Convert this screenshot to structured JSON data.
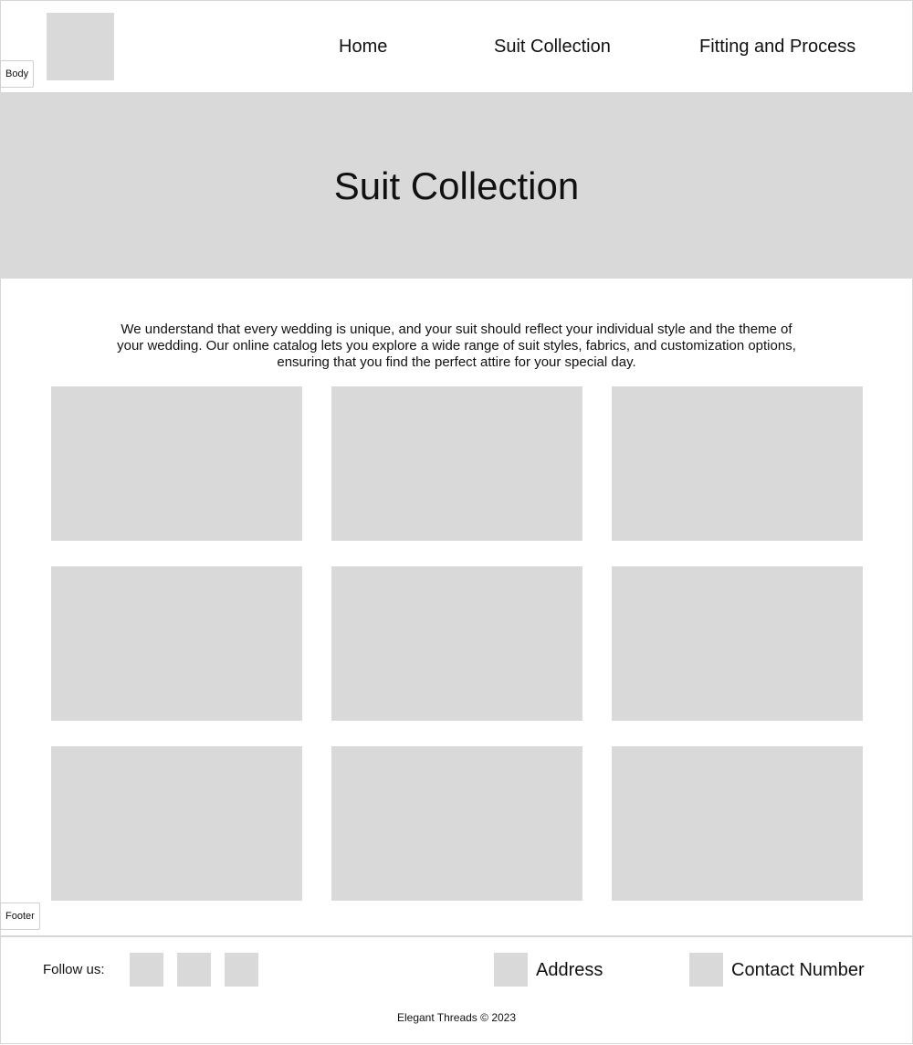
{
  "labels": {
    "body": "Body",
    "footer": "Footer"
  },
  "header": {
    "logo": "logo-placeholder",
    "nav": {
      "home": "Home",
      "suits": "Suit Collection",
      "fitting": "Fitting and Process"
    }
  },
  "hero": {
    "title": "Suit Collection"
  },
  "intro": {
    "text": "We understand that every wedding is unique, and your suit should reflect your individual style and the theme of your wedding. Our online catalog lets you explore a wide range of suit styles, fabrics, and customization options, ensuring that you find the perfect attire for your special day."
  },
  "footer": {
    "follow_label": "Follow us:",
    "address_label": "Address",
    "contact_label": "Contact Number",
    "copyright": "Elegant Threads © 2023"
  },
  "colors": {
    "placeholder": "#d9d9d9",
    "border": "#d6d6d6",
    "text": "#111111"
  }
}
